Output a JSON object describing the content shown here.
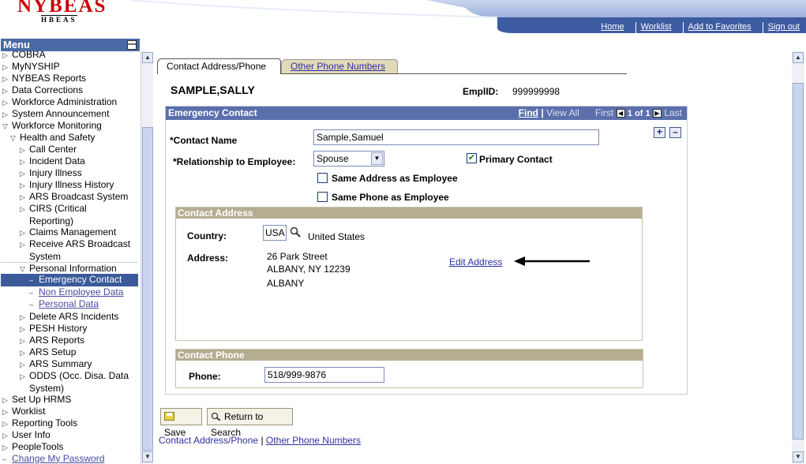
{
  "header": {
    "logo_text": "NYBEAS",
    "logo_subtext": "HBEAS",
    "links": [
      "Home",
      "Worklist",
      "Add to Favorites",
      "Sign out"
    ]
  },
  "menu": {
    "title": "Menu",
    "items": [
      {
        "label": "COBRA",
        "level": 0,
        "type": "collapsed"
      },
      {
        "label": "MyNYSHIP",
        "level": 0,
        "type": "collapsed"
      },
      {
        "label": "NYBEAS Reports",
        "level": 0,
        "type": "collapsed"
      },
      {
        "label": "Data Corrections",
        "level": 0,
        "type": "collapsed"
      },
      {
        "label": "Workforce Administration",
        "level": 0,
        "type": "collapsed"
      },
      {
        "label": "System Announcement",
        "level": 0,
        "type": "collapsed"
      },
      {
        "label": "Workforce Monitoring",
        "level": 0,
        "type": "expanded"
      },
      {
        "label": "Health and Safety",
        "level": 1,
        "type": "expanded"
      },
      {
        "label": "Call Center",
        "level": 2,
        "type": "collapsed"
      },
      {
        "label": "Incident Data",
        "level": 2,
        "type": "collapsed"
      },
      {
        "label": "Injury Illness",
        "level": 2,
        "type": "collapsed"
      },
      {
        "label": "Injury Illness History",
        "level": 2,
        "type": "collapsed"
      },
      {
        "label": "ARS Broadcast System",
        "level": 2,
        "type": "collapsed"
      },
      {
        "label": "CIRS (Critical",
        "label2": "Reporting)",
        "level": 2,
        "type": "collapsed"
      },
      {
        "label": "Claims Management",
        "level": 2,
        "type": "collapsed"
      },
      {
        "label": "Receive ARS Broadcast",
        "label2": "System",
        "level": 2,
        "type": "collapsed"
      },
      {
        "label": "Personal Information",
        "level": 2,
        "type": "expanded"
      },
      {
        "label": "Emergency Contact",
        "level": 3,
        "type": "selected"
      },
      {
        "label": "Non Employee Data",
        "level": 3,
        "type": "link"
      },
      {
        "label": "Personal Data",
        "level": 3,
        "type": "link"
      },
      {
        "label": "Delete ARS Incidents",
        "level": 2,
        "type": "collapsed"
      },
      {
        "label": "PESH History",
        "level": 2,
        "type": "collapsed"
      },
      {
        "label": "ARS Reports",
        "level": 2,
        "type": "collapsed"
      },
      {
        "label": "ARS Setup",
        "level": 2,
        "type": "collapsed"
      },
      {
        "label": "ARS Summary",
        "level": 2,
        "type": "collapsed"
      },
      {
        "label": "ODDS (Occ. Disa. Data",
        "label2": "System)",
        "level": 2,
        "type": "collapsed"
      },
      {
        "label": "Set Up HRMS",
        "level": 0,
        "type": "collapsed"
      },
      {
        "label": "Worklist",
        "level": 0,
        "type": "collapsed"
      },
      {
        "label": "Reporting Tools",
        "level": 0,
        "type": "collapsed"
      },
      {
        "label": "User Info",
        "level": 0,
        "type": "collapsed"
      },
      {
        "label": "PeopleTools",
        "level": 0,
        "type": "collapsed"
      },
      {
        "label": "Change My Password",
        "level": 0,
        "type": "link"
      }
    ]
  },
  "tabs": {
    "active": "Contact Address/Phone",
    "inactive": "Other Phone Numbers"
  },
  "employee": {
    "name": "SAMPLE,SALLY",
    "emplid_label": "EmplID:",
    "emplid": "999999998"
  },
  "emergency_contact": {
    "header": "Emergency Contact",
    "nav": {
      "find": "Find",
      "view_all": "View All",
      "first": "First",
      "count": "1 of 1",
      "last": "Last"
    },
    "contact_name_label": "*Contact Name",
    "contact_name": "Sample,Samuel",
    "relationship_label": "*Relationship to Employee:",
    "relationship": "Spouse",
    "primary_contact_label": "Primary Contact",
    "primary_contact_checked": true,
    "same_address_label": "Same Address as Employee",
    "same_phone_label": "Same Phone as Employee"
  },
  "contact_address": {
    "header": "Contact Address",
    "country_label": "Country:",
    "country_code": "USA",
    "country_name": "United States",
    "address_label": "Address:",
    "address_lines": [
      "26 Park Street",
      "ALBANY, NY 12239",
      "ALBANY"
    ],
    "edit_link": "Edit Address"
  },
  "contact_phone": {
    "header": "Contact Phone",
    "phone_label": "Phone:",
    "phone": "518/999-9876"
  },
  "actions": {
    "save": "Save",
    "return": "Return to Search"
  },
  "bottom_links": {
    "current": "Contact Address/Phone",
    "separator": "|",
    "other": "Other Phone Numbers"
  }
}
